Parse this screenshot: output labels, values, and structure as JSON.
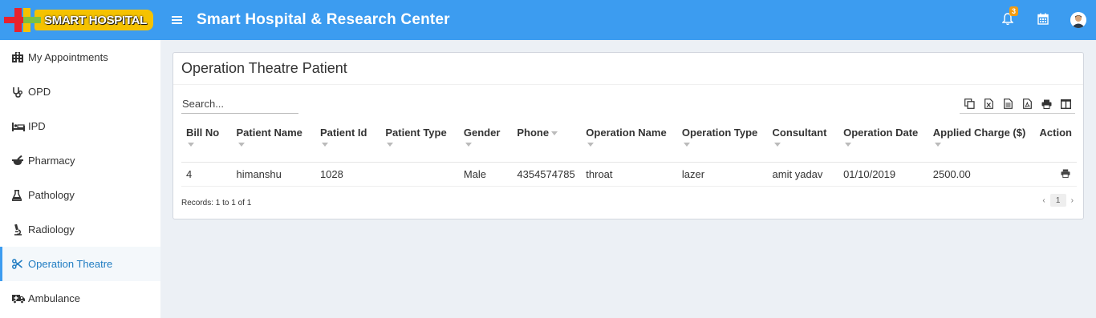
{
  "header": {
    "logo_text": "SMART HOSPITAL",
    "title": "Smart Hospital & Research Center",
    "notification_count": "3",
    "icons": [
      "menu-icon",
      "bell-icon",
      "calendar-icon",
      "user-avatar"
    ],
    "colors": {
      "bar": "#3c9cf0",
      "badge": "#f39c12",
      "logo_bg": "#f5c200"
    }
  },
  "sidebar": {
    "items": [
      {
        "label": "My Appointments",
        "icon": "hospital-icon",
        "active": false
      },
      {
        "label": "OPD",
        "icon": "stethoscope-icon",
        "active": false
      },
      {
        "label": "IPD",
        "icon": "bed-icon",
        "active": false
      },
      {
        "label": "Pharmacy",
        "icon": "mortar-pestle-icon",
        "active": false
      },
      {
        "label": "Pathology",
        "icon": "flask-icon",
        "active": false
      },
      {
        "label": "Radiology",
        "icon": "microscope-icon",
        "active": false
      },
      {
        "label": "Operation Theatre",
        "icon": "scissors-icon",
        "active": true
      },
      {
        "label": "Ambulance",
        "icon": "ambulance-icon",
        "active": false
      }
    ]
  },
  "main": {
    "title": "Operation Theatre Patient",
    "search_placeholder": "Search...",
    "tools": [
      "copy-icon",
      "excel-icon",
      "csv-icon",
      "pdf-icon",
      "print-icon",
      "columns-icon"
    ],
    "columns": [
      "Bill No",
      "Patient Name",
      "Patient Id",
      "Patient Type",
      "Gender",
      "Phone",
      "Operation Name",
      "Operation Type",
      "Consultant",
      "Operation Date",
      "Applied Charge ($)",
      "Action"
    ],
    "rows": [
      {
        "bill_no": "4",
        "patient_name": "himanshu",
        "patient_id": "1028",
        "patient_type": "",
        "gender": "Male",
        "phone": "4354574785",
        "operation_name": "throat",
        "operation_type": "lazer",
        "consultant": "amit yadav",
        "operation_date": "01/10/2019",
        "applied_charge": "2500.00"
      }
    ],
    "records_text": "Records: 1 to 1 of 1",
    "pagination": {
      "prev": "‹",
      "current": "1",
      "next": "›"
    }
  }
}
